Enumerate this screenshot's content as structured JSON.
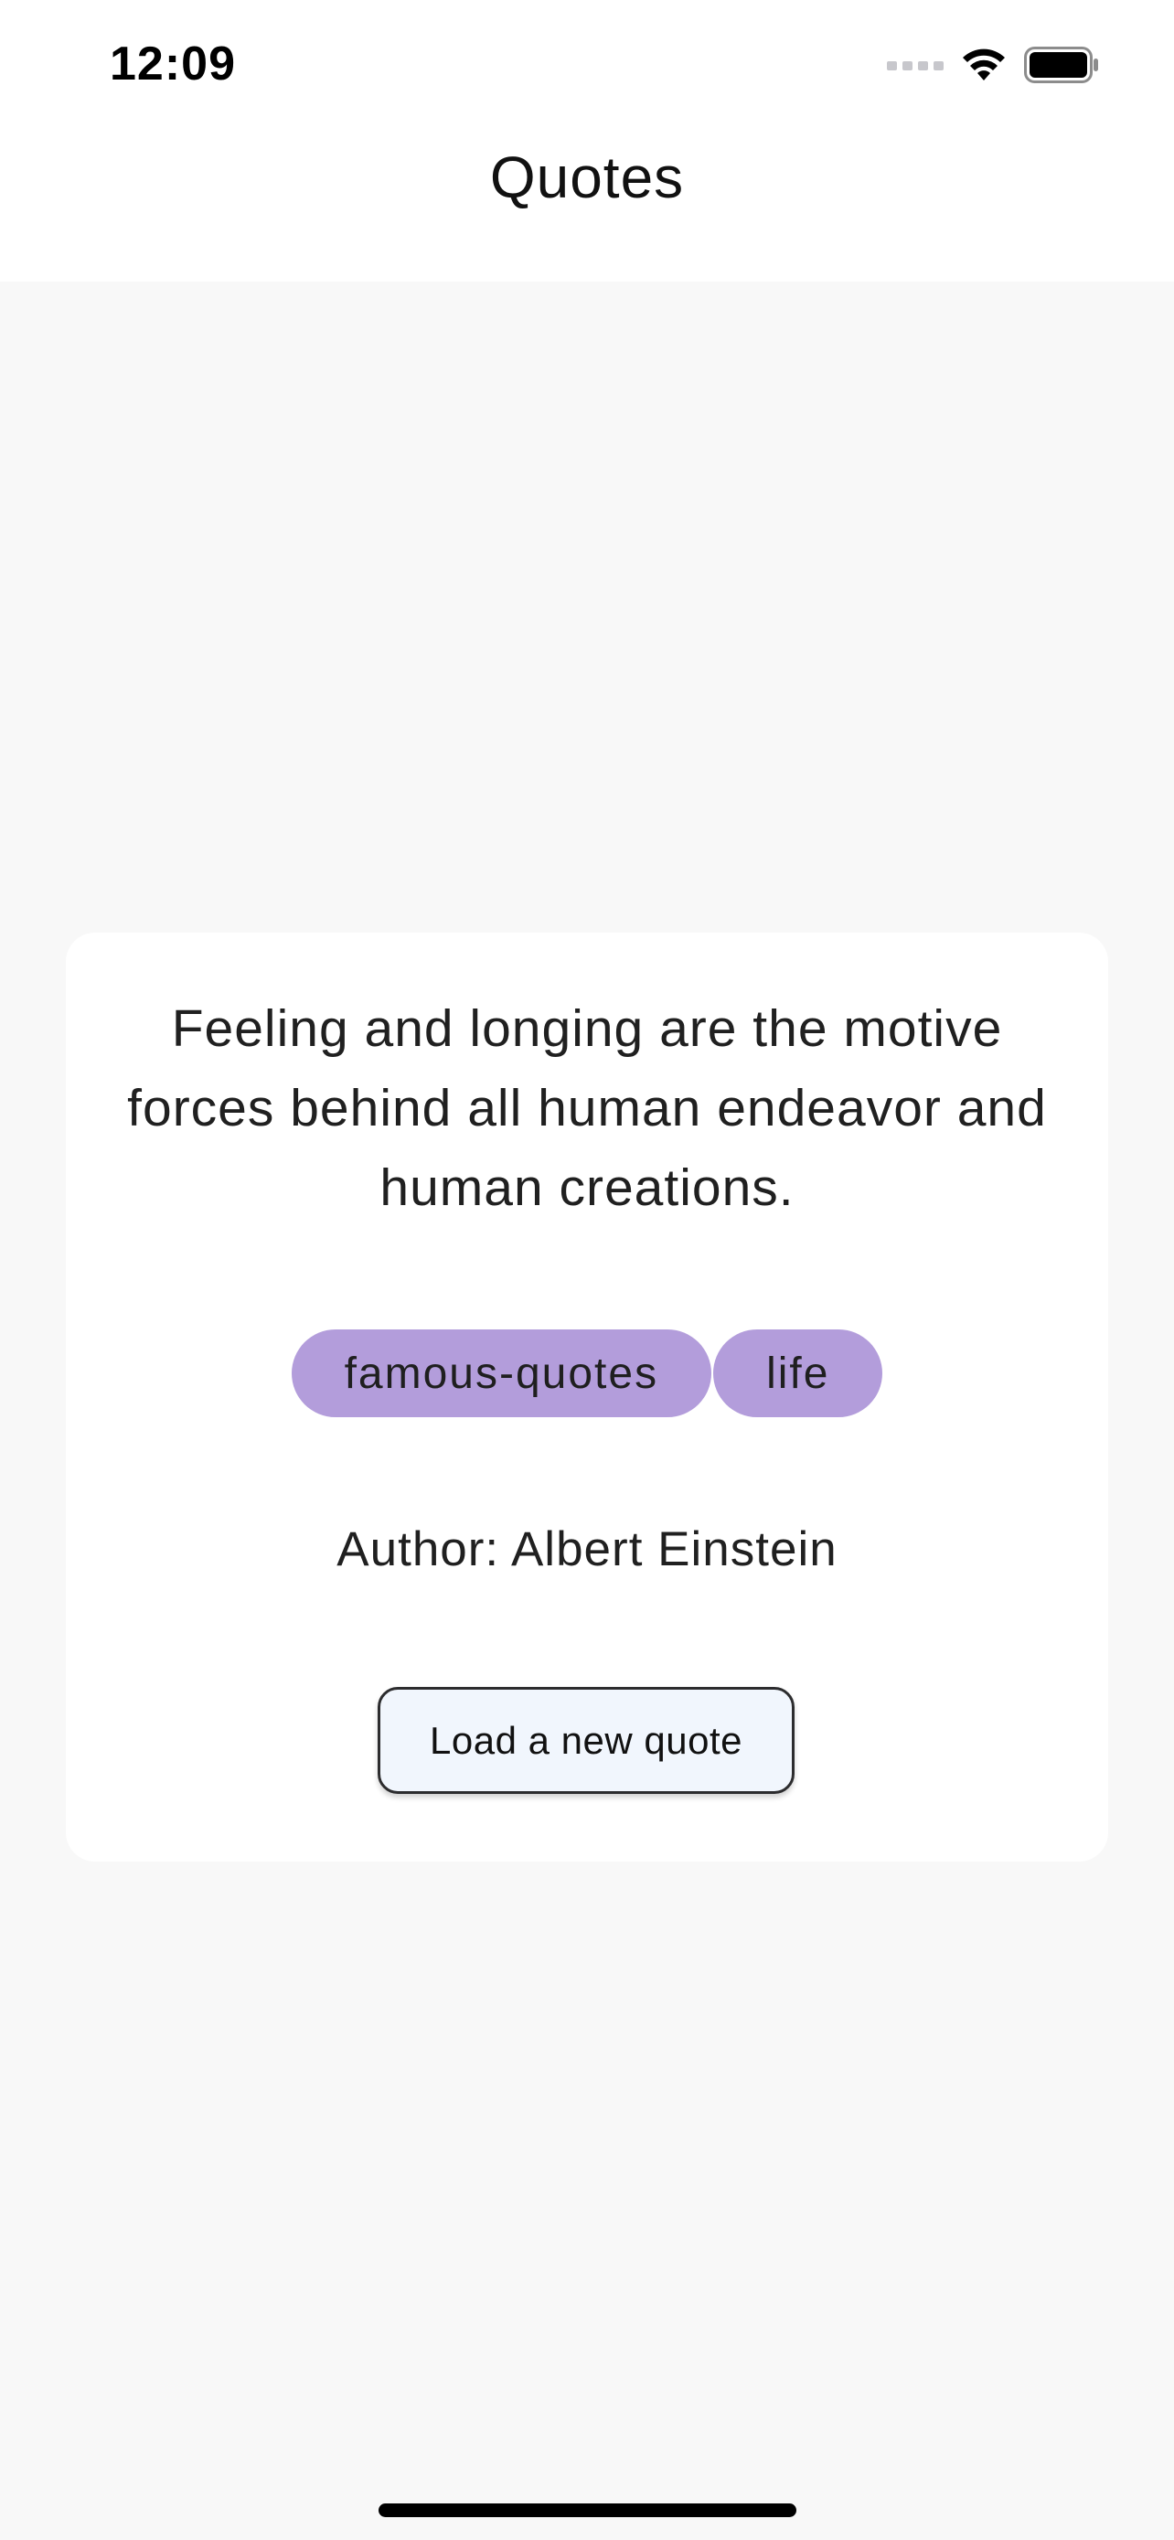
{
  "status_bar": {
    "time": "12:09",
    "icons": [
      "signal-icon",
      "wifi-icon",
      "battery-icon"
    ]
  },
  "nav": {
    "title": "Quotes"
  },
  "quote": {
    "text": "Feeling and longing are the motive forces behind all human endeavor and human creations.",
    "tags": [
      "famous-quotes",
      "life"
    ],
    "author": "Author: Albert Einstein"
  },
  "actions": {
    "load_button_label": "Load a new quote"
  },
  "colors": {
    "background": "#f8f8f8",
    "card": "#ffffff",
    "tag": "#b39ddb",
    "button_bg": "#f1f6fd"
  }
}
